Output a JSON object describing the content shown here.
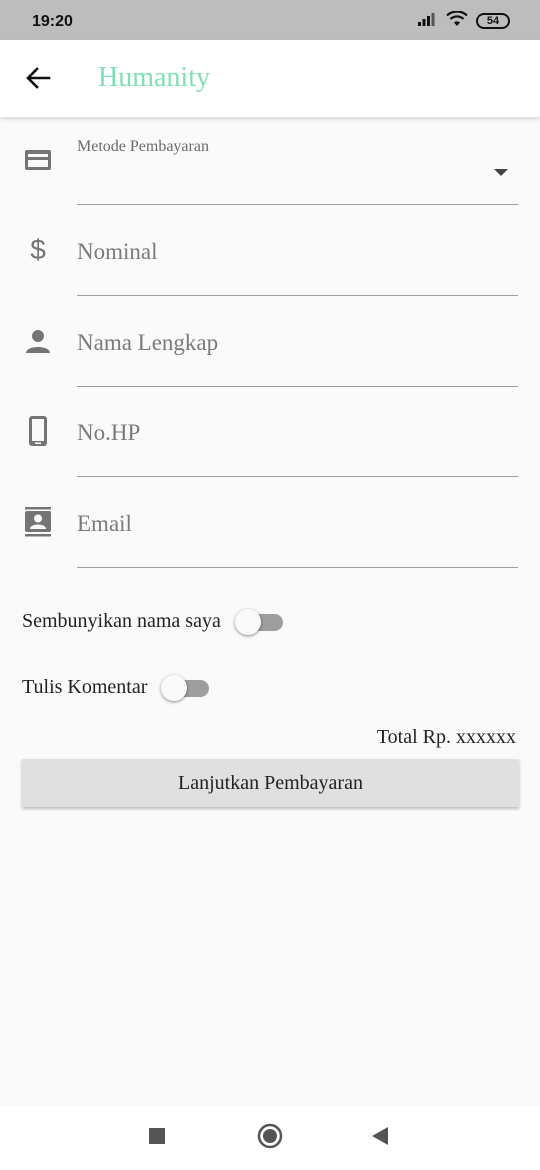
{
  "status_bar": {
    "time": "19:20",
    "battery": "54",
    "icons": [
      "signal-icon",
      "wifi-icon",
      "battery-icon"
    ]
  },
  "app_bar": {
    "title": "Humanity",
    "title_color": "#7fe0b7",
    "back_icon": "arrow-left-icon"
  },
  "form": {
    "payment_method": {
      "label": "Metode Pembayaran",
      "value": "",
      "icon": "credit-card-icon"
    },
    "nominal": {
      "placeholder": "Nominal",
      "icon": "dollar-icon"
    },
    "full_name": {
      "placeholder": "Nama Lengkap",
      "icon": "person-icon"
    },
    "phone": {
      "placeholder": "No.HP",
      "icon": "phone-icon"
    },
    "email": {
      "placeholder": "Email",
      "icon": "contact-card-icon"
    }
  },
  "toggles": {
    "hide_name": {
      "label": "Sembunyikan nama saya",
      "checked": false
    },
    "write_comment": {
      "label": "Tulis Komentar",
      "checked": false
    }
  },
  "total": "Total Rp. xxxxxx",
  "continue_button": "Lanjutkan Pembayaran",
  "nav_bar": {
    "buttons": [
      "recents-square-icon",
      "home-circle-icon",
      "back-triangle-icon"
    ]
  }
}
